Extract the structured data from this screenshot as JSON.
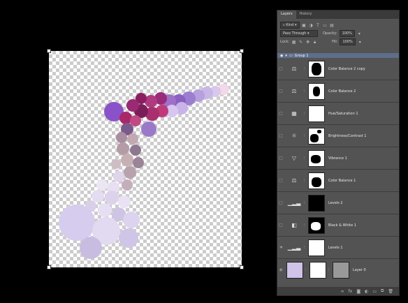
{
  "tabs": [
    "Layers",
    "History"
  ],
  "kind_label": "Kind",
  "blend_mode": "Pass Through",
  "opacity_label": "Opacity:",
  "opacity_value": "100%",
  "lock_label": "Lock:",
  "fill_label": "Fill:",
  "fill_value": "100%",
  "group_name": "Group 1",
  "layers": [
    {
      "name": "Color Balance 2 copy",
      "icon": "⚖"
    },
    {
      "name": "Color Balance 2",
      "icon": "⚖"
    },
    {
      "name": "Hue/Saturation 1",
      "icon": "▦"
    },
    {
      "name": "Brightness/Contrast 1",
      "icon": "☼"
    },
    {
      "name": "Vibrance 1",
      "icon": "▽"
    },
    {
      "name": "Color Balance 1",
      "icon": "⚖"
    },
    {
      "name": "Levels 2",
      "icon": "▁▂▃"
    },
    {
      "name": "Black & White 1",
      "icon": "◧"
    },
    {
      "name": "Levels 1",
      "icon": "▁▂▃"
    }
  ],
  "base_layer": "Layer 0",
  "colors": {
    "panel": "#535353",
    "group_highlight": "#5e6e8a"
  }
}
